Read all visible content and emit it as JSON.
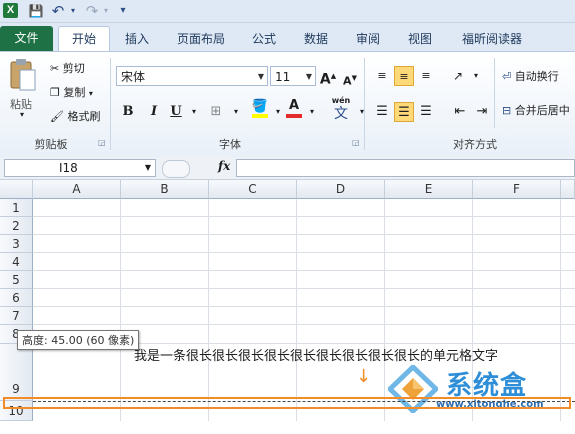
{
  "qat": {
    "app_logo": "X",
    "save_icon": "💾",
    "undo_icon": "↶",
    "redo_icon": "↷",
    "customize_icon": "▾"
  },
  "tabs": [
    {
      "label": "文件"
    },
    {
      "label": "开始"
    },
    {
      "label": "插入"
    },
    {
      "label": "页面布局"
    },
    {
      "label": "公式"
    },
    {
      "label": "数据"
    },
    {
      "label": "审阅"
    },
    {
      "label": "视图"
    },
    {
      "label": "福昕阅读器"
    }
  ],
  "clipboard": {
    "paste_label": "粘贴",
    "cut_label": "剪切",
    "copy_label": "复制",
    "format_painter_label": "格式刷",
    "group_label": "剪贴板"
  },
  "font": {
    "font_name": "宋体",
    "font_size": "11",
    "grow_label": "A",
    "shrink_label": "A",
    "bold_label": "B",
    "italic_label": "I",
    "underline_label": "U",
    "font_color_label": "A",
    "phonetic_label": "wén",
    "phonetic_glyph": "文",
    "group_label": "字体"
  },
  "alignment": {
    "wrap_label": "自动换行",
    "merge_label": "合并后居中",
    "group_label": "对齐方式"
  },
  "formula_bar": {
    "name_box": "I18",
    "fx_label": "fx",
    "value": ""
  },
  "columns": [
    "A",
    "B",
    "C",
    "D",
    "E",
    "F"
  ],
  "rows": [
    "1",
    "2",
    "3",
    "4",
    "5",
    "6",
    "7",
    "8",
    "9",
    "10"
  ],
  "cell_text": "我是一条很长很长很长很长很长很长很长很长很长的单元格文字",
  "tooltip": "高度: 45.00 (60 像素)",
  "arrow_icon": "↓",
  "watermark": {
    "text": "系统盒",
    "url": "www.xitonghe.com"
  },
  "colors": {
    "file_tab": "#1e7145",
    "highlight": "#f28c28",
    "active_button": "#ffd978"
  }
}
